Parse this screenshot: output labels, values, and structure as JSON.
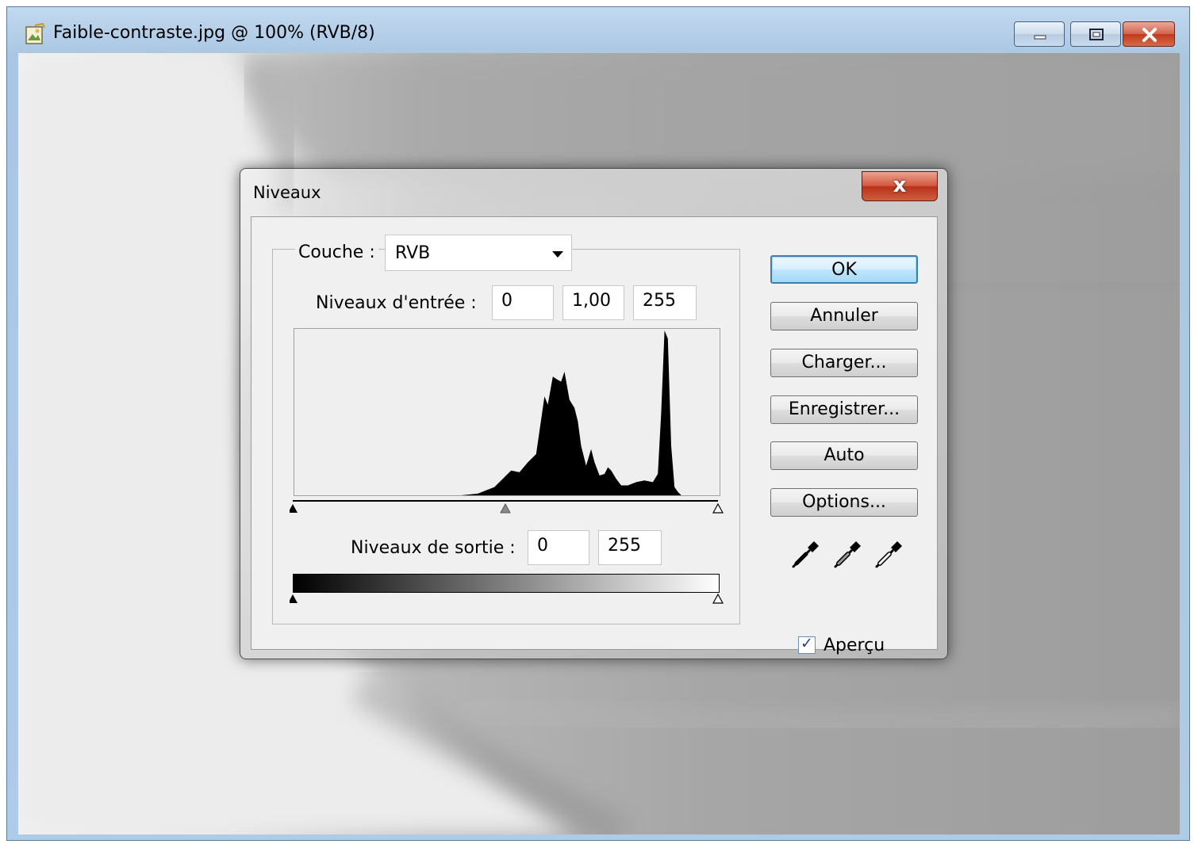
{
  "window": {
    "title": "Faible-contraste.jpg @ 100% (RVB/8)"
  },
  "dialog": {
    "title": "Niveaux",
    "close_label": "x",
    "channel": {
      "label": "Couche :",
      "value": "RVB"
    },
    "input_levels": {
      "label": "Niveaux d'entrée :",
      "black": "0",
      "gamma": "1,00",
      "white": "255"
    },
    "output_levels": {
      "label": "Niveaux de sortie :",
      "black": "0",
      "white": "255"
    },
    "buttons": {
      "ok": "OK",
      "cancel": "Annuler",
      "load": "Charger...",
      "save": "Enregistrer...",
      "auto": "Auto",
      "options": "Options..."
    },
    "eyedroppers": [
      "black-eyedropper-icon",
      "gray-eyedropper-icon",
      "white-eyedropper-icon"
    ],
    "preview": {
      "label": "Aperçu",
      "checked": true
    }
  },
  "chart_data": {
    "type": "area",
    "xlim": [
      0,
      255
    ],
    "ylim": [
      0,
      1
    ],
    "x": [
      100,
      110,
      115,
      120,
      125,
      130,
      135,
      140,
      145,
      150,
      152,
      155,
      158,
      160,
      162,
      165,
      168,
      170,
      172,
      175,
      178,
      180,
      183,
      186,
      188,
      190,
      193,
      196,
      200,
      205,
      210,
      215,
      218,
      220,
      222,
      224,
      226,
      228,
      230,
      232
    ],
    "y": [
      0.0,
      0.01,
      0.03,
      0.05,
      0.1,
      0.15,
      0.14,
      0.2,
      0.25,
      0.6,
      0.55,
      0.72,
      0.7,
      0.69,
      0.75,
      0.58,
      0.53,
      0.45,
      0.3,
      0.18,
      0.28,
      0.2,
      0.12,
      0.13,
      0.17,
      0.15,
      0.1,
      0.06,
      0.06,
      0.08,
      0.09,
      0.08,
      0.13,
      0.5,
      1.0,
      0.95,
      0.3,
      0.05,
      0.02,
      0.0
    ],
    "input_markers": {
      "black": 0,
      "gamma": 1.0,
      "white": 255
    },
    "output_markers": {
      "black": 0,
      "white": 255
    }
  },
  "colors": {
    "ok_border": "#3c7fb1",
    "close_red": "#c03a1c"
  }
}
